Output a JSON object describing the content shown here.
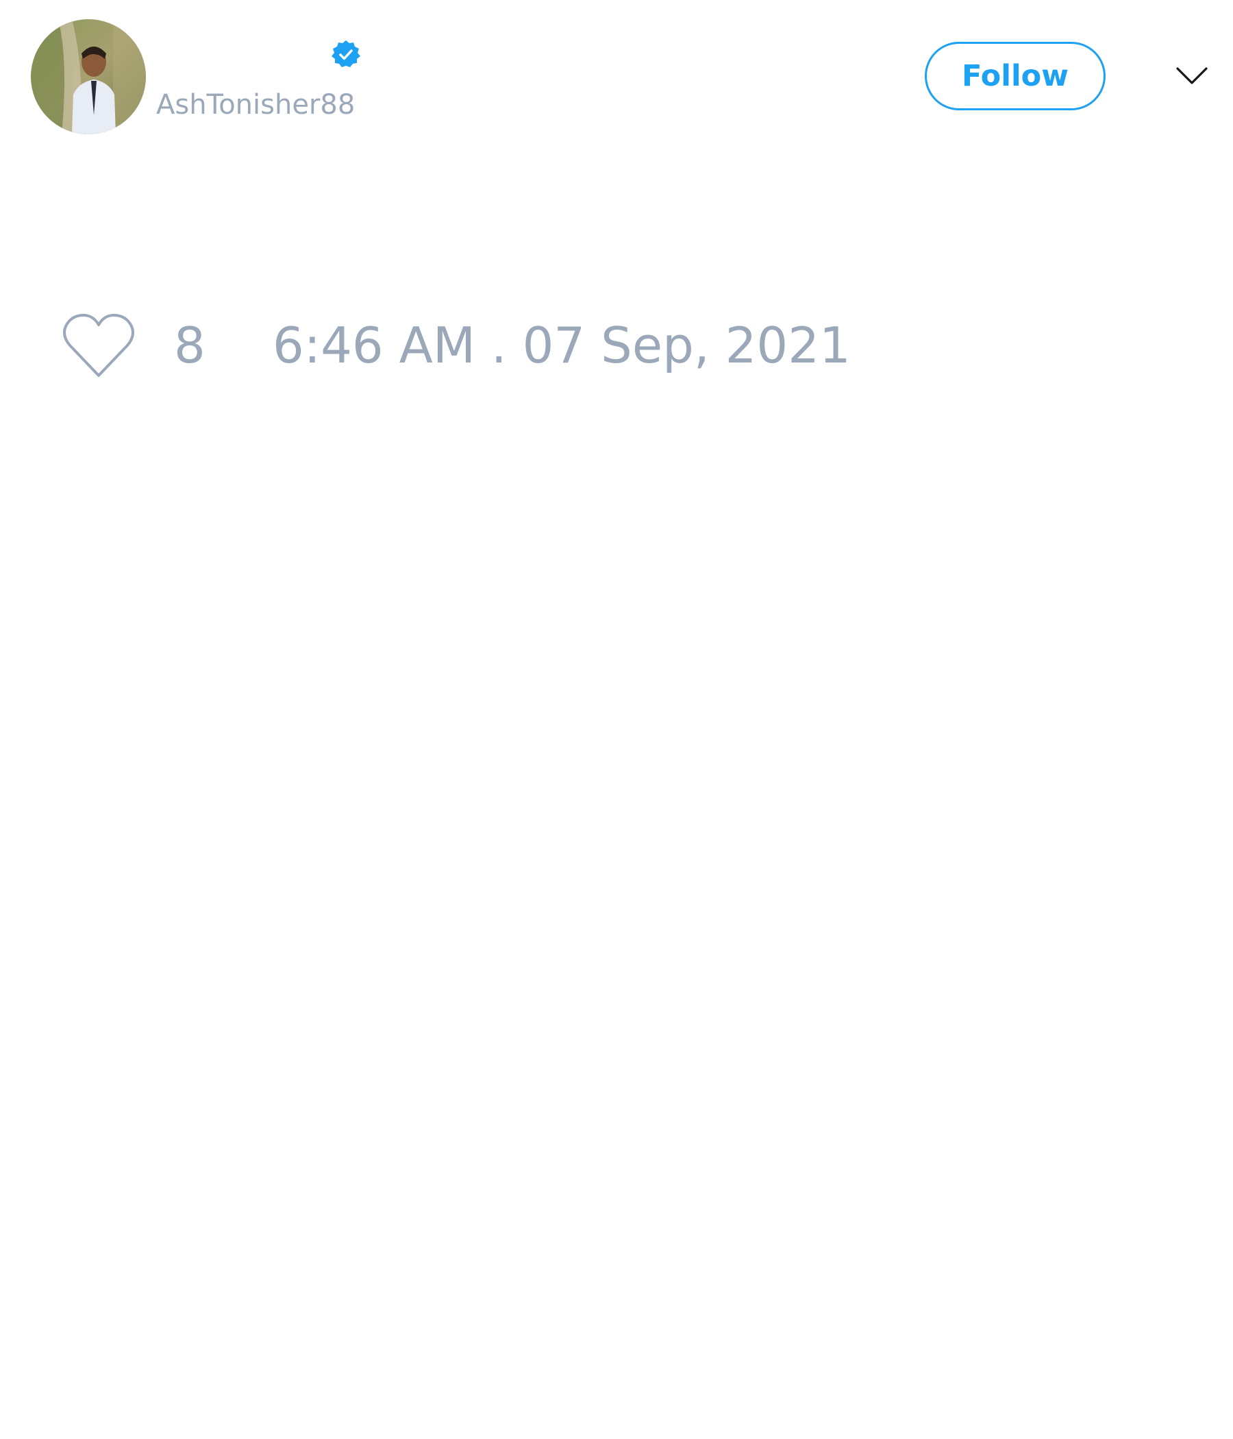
{
  "author": {
    "handle": "AshTonisher88",
    "verified": true,
    "avatar_icon": "user-avatar-photo"
  },
  "actions": {
    "follow_label": "Follow",
    "menu_icon": "chevron-down-icon"
  },
  "tweet": {
    "like_icon": "heart-outline-icon",
    "like_count": "8",
    "timestamp": "6:46 AM . 07 Sep, 2021"
  },
  "colors": {
    "accent": "#1da1f2",
    "muted_text": "#9aa8ba",
    "background": "#ffffff"
  }
}
